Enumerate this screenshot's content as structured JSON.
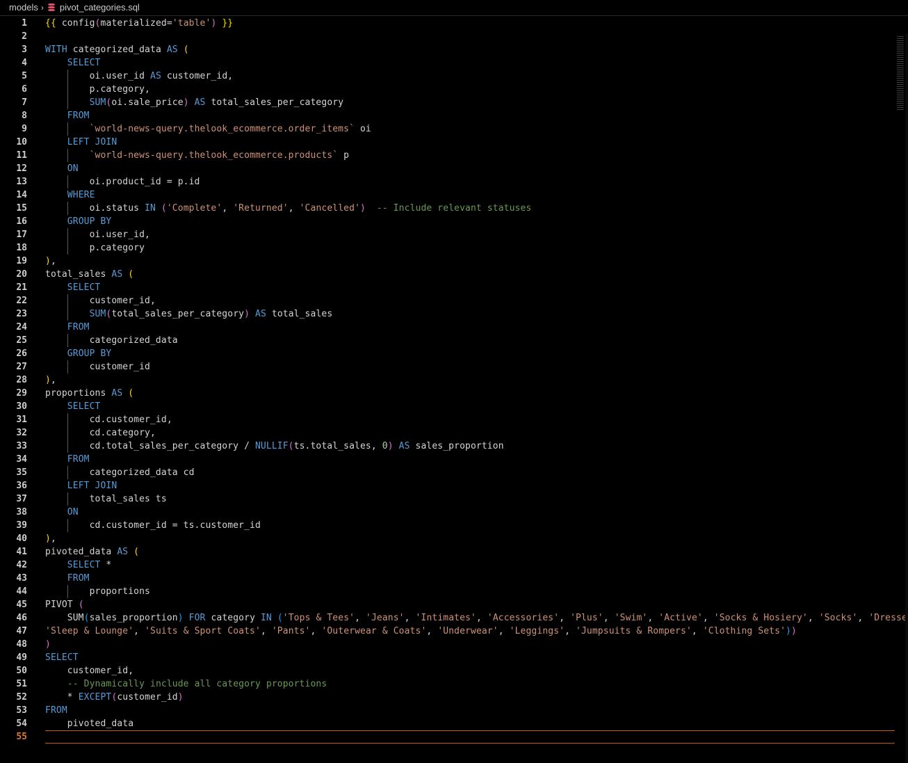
{
  "breadcrumb": {
    "folder": "models",
    "file": "pivot_categories.sql"
  },
  "editor": {
    "current_line": 55,
    "lines": [
      [
        [
          "b1",
          "{{"
        ],
        [
          "t",
          " config"
        ],
        [
          "b2",
          "("
        ],
        [
          "t",
          "materialized="
        ],
        [
          "str",
          "'table'"
        ],
        [
          "b2",
          ")"
        ],
        [
          "t",
          " "
        ],
        [
          "b1",
          "}}"
        ]
      ],
      [],
      [
        [
          "kw",
          "WITH"
        ],
        [
          "t",
          " categorized_data "
        ],
        [
          "kw",
          "AS"
        ],
        [
          "t",
          " "
        ],
        [
          "b1",
          "("
        ]
      ],
      [
        [
          "t",
          "    "
        ],
        [
          "kw",
          "SELECT"
        ]
      ],
      [
        [
          "t",
          "        oi.user_id "
        ],
        [
          "kw",
          "AS"
        ],
        [
          "t",
          " customer_id,"
        ]
      ],
      [
        [
          "t",
          "        p.category,"
        ]
      ],
      [
        [
          "t",
          "        "
        ],
        [
          "kw",
          "SUM"
        ],
        [
          "b2",
          "("
        ],
        [
          "t",
          "oi.sale_price"
        ],
        [
          "b2",
          ")"
        ],
        [
          "t",
          " "
        ],
        [
          "kw",
          "AS"
        ],
        [
          "t",
          " total_sales_per_category"
        ]
      ],
      [
        [
          "t",
          "    "
        ],
        [
          "kw",
          "FROM"
        ]
      ],
      [
        [
          "t",
          "        "
        ],
        [
          "str",
          "`world-news-query.thelook_ecommerce.order_items`"
        ],
        [
          "t",
          " oi"
        ]
      ],
      [
        [
          "t",
          "    "
        ],
        [
          "kw",
          "LEFT JOIN"
        ]
      ],
      [
        [
          "t",
          "        "
        ],
        [
          "str",
          "`world-news-query.thelook_ecommerce.products`"
        ],
        [
          "t",
          " p"
        ]
      ],
      [
        [
          "t",
          "    "
        ],
        [
          "kw",
          "ON"
        ]
      ],
      [
        [
          "t",
          "        oi.product_id = p.id"
        ]
      ],
      [
        [
          "t",
          "    "
        ],
        [
          "kw",
          "WHERE"
        ]
      ],
      [
        [
          "t",
          "        oi.status "
        ],
        [
          "kw",
          "IN"
        ],
        [
          "t",
          " "
        ],
        [
          "b2",
          "("
        ],
        [
          "str",
          "'Complete'"
        ],
        [
          "t",
          ", "
        ],
        [
          "str",
          "'Returned'"
        ],
        [
          "t",
          ", "
        ],
        [
          "str",
          "'Cancelled'"
        ],
        [
          "b2",
          ")"
        ],
        [
          "t",
          "  "
        ],
        [
          "com",
          "-- Include relevant statuses"
        ]
      ],
      [
        [
          "t",
          "    "
        ],
        [
          "kw",
          "GROUP BY"
        ]
      ],
      [
        [
          "t",
          "        oi.user_id,"
        ]
      ],
      [
        [
          "t",
          "        p.category"
        ]
      ],
      [
        [
          "b1",
          ")"
        ],
        [
          "t",
          ","
        ]
      ],
      [
        [
          "t",
          "total_sales "
        ],
        [
          "kw",
          "AS"
        ],
        [
          "t",
          " "
        ],
        [
          "b1",
          "("
        ]
      ],
      [
        [
          "t",
          "    "
        ],
        [
          "kw",
          "SELECT"
        ]
      ],
      [
        [
          "t",
          "        customer_id,"
        ]
      ],
      [
        [
          "t",
          "        "
        ],
        [
          "kw",
          "SUM"
        ],
        [
          "b2",
          "("
        ],
        [
          "t",
          "total_sales_per_category"
        ],
        [
          "b2",
          ")"
        ],
        [
          "t",
          " "
        ],
        [
          "kw",
          "AS"
        ],
        [
          "t",
          " total_sales"
        ]
      ],
      [
        [
          "t",
          "    "
        ],
        [
          "kw",
          "FROM"
        ]
      ],
      [
        [
          "t",
          "        categorized_data"
        ]
      ],
      [
        [
          "t",
          "    "
        ],
        [
          "kw",
          "GROUP BY"
        ]
      ],
      [
        [
          "t",
          "        customer_id"
        ]
      ],
      [
        [
          "b1",
          ")"
        ],
        [
          "t",
          ","
        ]
      ],
      [
        [
          "t",
          "proportions "
        ],
        [
          "kw",
          "AS"
        ],
        [
          "t",
          " "
        ],
        [
          "b1",
          "("
        ]
      ],
      [
        [
          "t",
          "    "
        ],
        [
          "kw",
          "SELECT"
        ]
      ],
      [
        [
          "t",
          "        cd.customer_id,"
        ]
      ],
      [
        [
          "t",
          "        cd.category,"
        ]
      ],
      [
        [
          "t",
          "        cd.total_sales_per_category / "
        ],
        [
          "kw",
          "NULLIF"
        ],
        [
          "b2",
          "("
        ],
        [
          "t",
          "ts.total_sales, "
        ],
        [
          "num",
          "0"
        ],
        [
          "b2",
          ")"
        ],
        [
          "t",
          " "
        ],
        [
          "kw",
          "AS"
        ],
        [
          "t",
          " sales_proportion"
        ]
      ],
      [
        [
          "t",
          "    "
        ],
        [
          "kw",
          "FROM"
        ]
      ],
      [
        [
          "t",
          "        categorized_data cd"
        ]
      ],
      [
        [
          "t",
          "    "
        ],
        [
          "kw",
          "LEFT JOIN"
        ]
      ],
      [
        [
          "t",
          "        total_sales ts"
        ]
      ],
      [
        [
          "t",
          "    "
        ],
        [
          "kw",
          "ON"
        ]
      ],
      [
        [
          "t",
          "        cd.customer_id = ts.customer_id"
        ]
      ],
      [
        [
          "b1",
          ")"
        ],
        [
          "t",
          ","
        ]
      ],
      [
        [
          "t",
          "pivoted_data "
        ],
        [
          "kw",
          "AS"
        ],
        [
          "t",
          " "
        ],
        [
          "b1",
          "("
        ]
      ],
      [
        [
          "t",
          "    "
        ],
        [
          "kw",
          "SELECT"
        ],
        [
          "t",
          " *"
        ]
      ],
      [
        [
          "t",
          "    "
        ],
        [
          "kw",
          "FROM"
        ]
      ],
      [
        [
          "t",
          "        proportions"
        ]
      ],
      [
        [
          "t",
          "PIVOT "
        ],
        [
          "b2",
          "("
        ]
      ],
      [
        [
          "t",
          "    SUM"
        ],
        [
          "b3",
          "("
        ],
        [
          "t",
          "sales_proportion"
        ],
        [
          "b3",
          ")"
        ],
        [
          "t",
          " "
        ],
        [
          "kw",
          "FOR"
        ],
        [
          "t",
          " category "
        ],
        [
          "kw",
          "IN"
        ],
        [
          "t",
          " "
        ],
        [
          "b3",
          "("
        ],
        [
          "str",
          "'Tops & Tees'"
        ],
        [
          "t",
          ", "
        ],
        [
          "str",
          "'Jeans'"
        ],
        [
          "t",
          ", "
        ],
        [
          "str",
          "'Intimates'"
        ],
        [
          "t",
          ", "
        ],
        [
          "str",
          "'Accessories'"
        ],
        [
          "t",
          ", "
        ],
        [
          "str",
          "'Plus'"
        ],
        [
          "t",
          ", "
        ],
        [
          "str",
          "'Swim'"
        ],
        [
          "t",
          ", "
        ],
        [
          "str",
          "'Active'"
        ],
        [
          "t",
          ", "
        ],
        [
          "str",
          "'Socks & Hosiery'"
        ],
        [
          "t",
          ", "
        ],
        [
          "str",
          "'Socks'"
        ],
        [
          "t",
          ", "
        ],
        [
          "str",
          "'Dresses'"
        ],
        [
          "t",
          ","
        ]
      ],
      [
        [
          "str",
          "'Sleep & Lounge'"
        ],
        [
          "t",
          ", "
        ],
        [
          "str",
          "'Suits & Sport Coats'"
        ],
        [
          "t",
          ", "
        ],
        [
          "str",
          "'Pants'"
        ],
        [
          "t",
          ", "
        ],
        [
          "str",
          "'Outerwear & Coats'"
        ],
        [
          "t",
          ", "
        ],
        [
          "str",
          "'Underwear'"
        ],
        [
          "t",
          ", "
        ],
        [
          "str",
          "'Leggings'"
        ],
        [
          "t",
          ", "
        ],
        [
          "str",
          "'Jumpsuits & Rompers'"
        ],
        [
          "t",
          ", "
        ],
        [
          "str",
          "'Clothing Sets'"
        ],
        [
          "b3",
          ")"
        ],
        [
          "b2",
          ")"
        ]
      ],
      [
        [
          "b2",
          ")"
        ]
      ],
      [
        [
          "kw",
          "SELECT"
        ]
      ],
      [
        [
          "t",
          "    customer_id,"
        ]
      ],
      [
        [
          "t",
          "    "
        ],
        [
          "com",
          "-- Dynamically include all category proportions"
        ]
      ],
      [
        [
          "t",
          "    * "
        ],
        [
          "kw",
          "EXCEPT"
        ],
        [
          "b2",
          "("
        ],
        [
          "t",
          "customer_id"
        ],
        [
          "b2",
          ")"
        ]
      ],
      [
        [
          "kw",
          "FROM"
        ]
      ],
      [
        [
          "t",
          "    pivoted_data"
        ]
      ],
      []
    ]
  },
  "colors": {
    "keyword": "#569cd6",
    "string": "#ce9178",
    "comment": "#6a9955",
    "number": "#b5cea8",
    "bracket_1": "#ffd700",
    "bracket_2": "#da70d6",
    "bracket_3": "#179fff",
    "current_line": "#e07b1f"
  },
  "icons": {
    "file": "database-icon",
    "separator": "chevron-right-icon"
  }
}
